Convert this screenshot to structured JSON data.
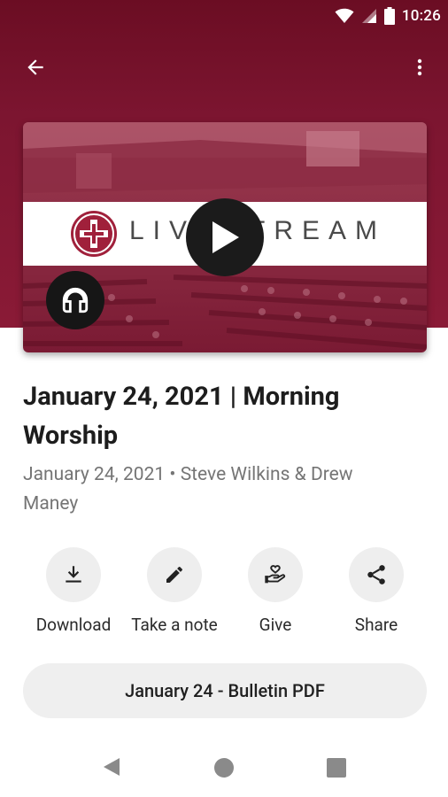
{
  "status_bar": {
    "time": "10:26"
  },
  "app_bar": {
    "back_icon": "arrow-back-icon",
    "more_icon": "more-vert-icon"
  },
  "media": {
    "banner_text": "LIVESTREAM",
    "play_icon": "play-icon",
    "audio_icon": "headphones-icon"
  },
  "sermon": {
    "title": "January 24, 2021 | Morning Worship",
    "meta": "January 24, 2021 • Steve Wilkins & Drew Maney"
  },
  "actions": [
    {
      "label": "Download",
      "icon": "download-icon"
    },
    {
      "label": "Take a note",
      "icon": "pencil-icon"
    },
    {
      "label": "Give",
      "icon": "heart-hand-icon"
    },
    {
      "label": "Share",
      "icon": "share-icon"
    }
  ],
  "bulletin": {
    "label": "January 24 - Bulletin PDF"
  },
  "colors": {
    "header": "#7c1530",
    "button_bg": "#eeeeee"
  }
}
